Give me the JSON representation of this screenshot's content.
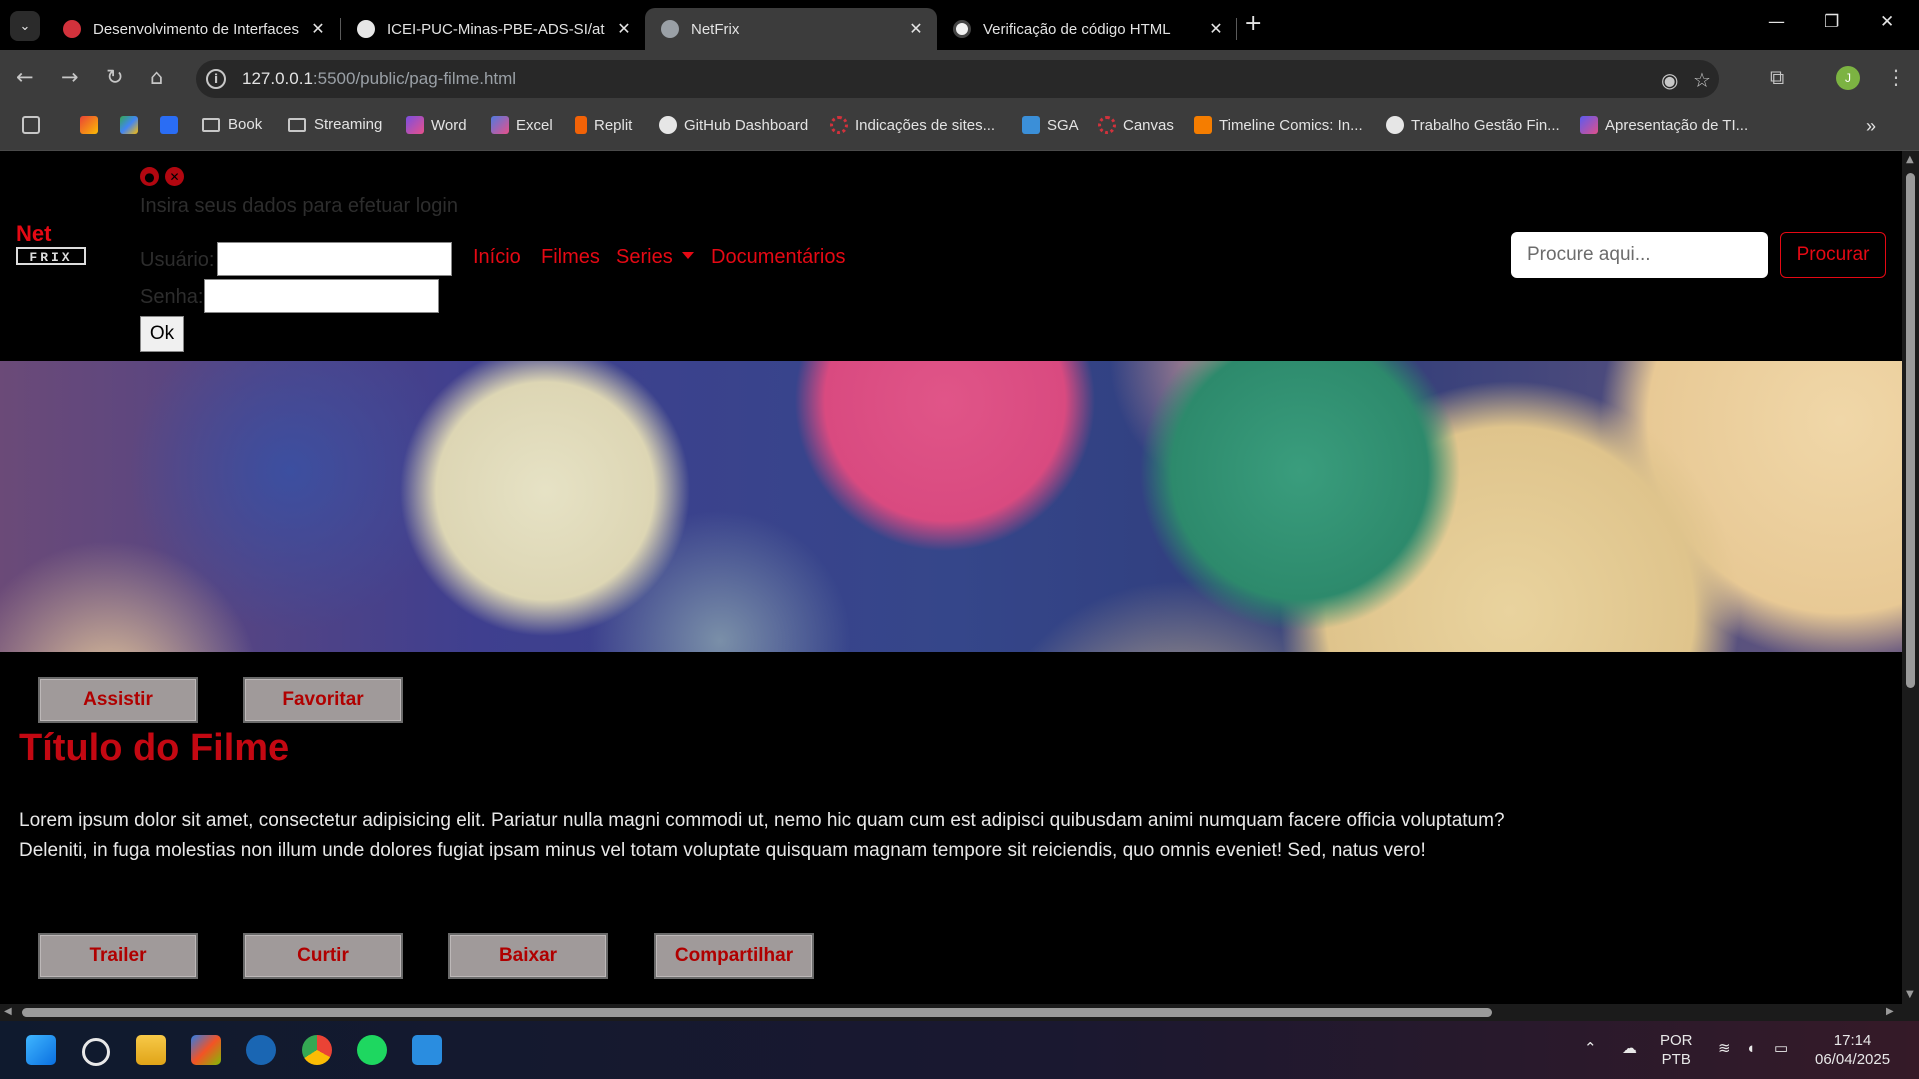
{
  "tabs": [
    {
      "title": "Desenvolvimento de Interfaces",
      "active": false
    },
    {
      "title": "ICEI-PUC-Minas-PBE-ADS-SI/at",
      "active": false
    },
    {
      "title": "NetFrix",
      "active": true
    },
    {
      "title": "Verificação de código HTML",
      "active": false
    }
  ],
  "address": {
    "host": "127.0.0.1",
    "rest": ":5500/public/pag-filme.html"
  },
  "bookmarks": [
    "Book",
    "Streaming",
    "Word",
    "Excel",
    "Replit",
    "GitHub Dashboard",
    "Indicações de sites...",
    "SGA",
    "Canvas",
    "Timeline Comics: In...",
    "Trabalho Gestão Fin...",
    "Apresentação de TI..."
  ],
  "profile_initial": "J",
  "logo": {
    "top": "Net",
    "bottom": "FRIX"
  },
  "login": {
    "hint": "Insira seus dados para efetuar login",
    "user_label": "Usuário:",
    "pass_label": "Senha:",
    "ok": "Ok"
  },
  "nav": {
    "inicio": "Início",
    "filmes": "Filmes",
    "series": "Series",
    "documentarios": "Documentários"
  },
  "search": {
    "placeholder": "Procure aqui...",
    "button": "Procurar"
  },
  "actions_top": [
    "Assistir",
    "Favoritar"
  ],
  "movie": {
    "title": "Título do Filme",
    "description": "Lorem ipsum dolor sit amet, consectetur adipisicing elit. Pariatur nulla magni commodi ut, nemo hic quam cum est adipisci quibusdam animi numquam facere officia voluptatum? Deleniti, in fuga molestias non illum unde dolores fugiat ipsam minus vel totam voluptate quisquam magnam tempore sit reiciendis, quo omnis eveniet! Sed, natus vero!"
  },
  "actions_bottom": [
    "Trailer",
    "Curtir",
    "Baixar",
    "Compartilhar"
  ],
  "taskbar": {
    "lang1": "POR",
    "lang2": "PTB",
    "time": "17:14",
    "date": "06/04/2025"
  },
  "colors": {
    "accent": "#e50914",
    "title": "#c40812",
    "button_bg": "#a09a9a",
    "button_text": "#b00000"
  }
}
